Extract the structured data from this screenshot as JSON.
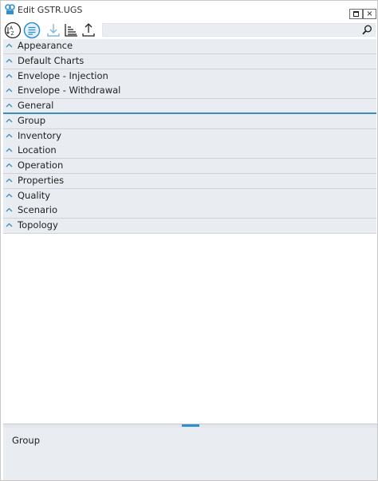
{
  "window": {
    "title": "Edit GSTR.UGS",
    "restore_label": "restore",
    "close_label": "×"
  },
  "toolbar": {
    "sort_alpha_label": "AZ",
    "search_placeholder": ""
  },
  "categories": [
    {
      "label": "Appearance"
    },
    {
      "label": "Default Charts"
    },
    {
      "label": "Envelope - Injection"
    },
    {
      "label": "Envelope - Withdrawal"
    },
    {
      "label": "General"
    },
    {
      "label": "Group"
    },
    {
      "label": "Inventory"
    },
    {
      "label": "Location"
    },
    {
      "label": "Operation"
    },
    {
      "label": "Properties"
    },
    {
      "label": "Quality"
    },
    {
      "label": "Scenario"
    },
    {
      "label": "Topology"
    }
  ],
  "selected_index": 4,
  "description": {
    "text": "Group"
  },
  "colors": {
    "accent": "#2f8fd0",
    "row_bg": "#e9ecf1",
    "chevron": "#3b8dbf"
  }
}
